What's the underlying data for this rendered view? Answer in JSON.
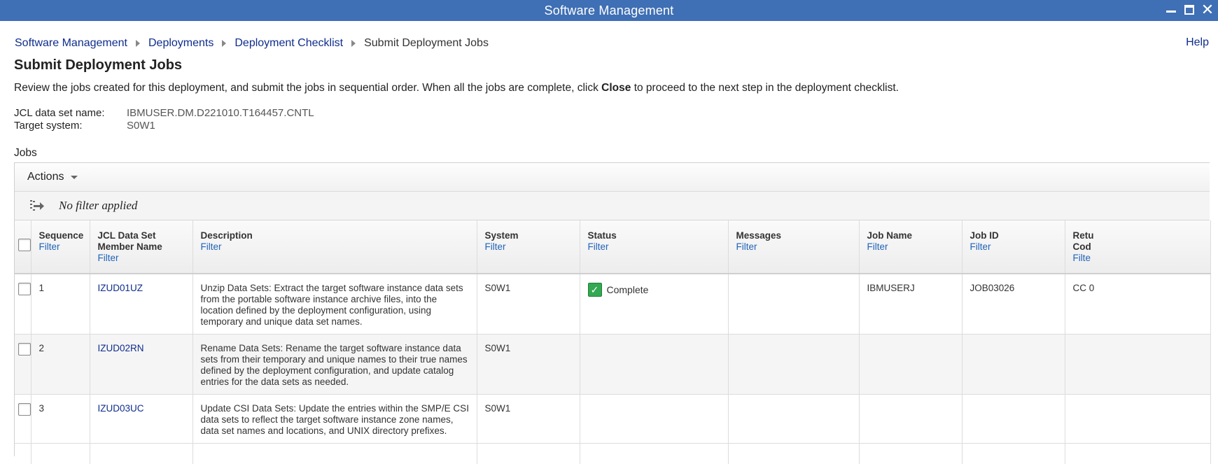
{
  "window": {
    "title": "Software Management"
  },
  "breadcrumb": {
    "items": [
      "Software Management",
      "Deployments",
      "Deployment Checklist"
    ],
    "current": "Submit Deployment Jobs"
  },
  "help_label": "Help",
  "page": {
    "title": "Submit Deployment Jobs",
    "description_before": "Review the jobs created for this deployment, and submit the jobs in sequential order. When all the jobs are complete, click ",
    "description_bold": "Close",
    "description_after": " to proceed to the next step in the deployment checklist."
  },
  "info": {
    "jcl_label": "JCL data set name:",
    "jcl_value": "IBMUSER.DM.D221010.T164457.CNTL",
    "target_label": "Target system:",
    "target_value": "S0W1"
  },
  "jobs_label": "Jobs",
  "toolbar": {
    "actions_label": "Actions",
    "filter_status": "No filter applied"
  },
  "columns": {
    "sequence": "Sequence",
    "member_name_1": "JCL Data Set",
    "member_name_2": "Member Name",
    "description": "Description",
    "system": "System",
    "status": "Status",
    "messages": "Messages",
    "job_name": "Job Name",
    "job_id": "Job ID",
    "return_code_1": "Retu",
    "return_code_2": "Cod",
    "filter_label": "Filter",
    "filter_label_clipped": "Filte"
  },
  "rows": [
    {
      "sequence": "1",
      "member": "IZUD01UZ",
      "description": "Unzip Data Sets: Extract the target software instance data sets from the portable software instance archive files, into the location defined by the deployment configuration, using temporary and unique data set names.",
      "system": "S0W1",
      "status": "Complete",
      "messages": "",
      "job_name": "IBMUSERJ",
      "job_id": "JOB03026",
      "return_code": "CC 0"
    },
    {
      "sequence": "2",
      "member": "IZUD02RN",
      "description": "Rename Data Sets: Rename the target software instance data sets from their temporary and unique names to their true names defined by the deployment configuration, and update catalog entries for the data sets as needed.",
      "system": "S0W1",
      "status": "",
      "messages": "",
      "job_name": "",
      "job_id": "",
      "return_code": ""
    },
    {
      "sequence": "3",
      "member": "IZUD03UC",
      "description": "Update CSI Data Sets: Update the entries within the SMP/E CSI data sets to reflect the target software instance zone names, data set names and locations, and UNIX directory prefixes.",
      "system": "S0W1",
      "status": "",
      "messages": "",
      "job_name": "",
      "job_id": "",
      "return_code": ""
    }
  ],
  "colors": {
    "titlebar": "#3f6fb4",
    "link": "#0f2d8c",
    "filter_link": "#2063b8",
    "status_complete": "#34a853"
  },
  "icons": {
    "status_complete": "check-icon",
    "filter": "filter-arrows-icon"
  }
}
